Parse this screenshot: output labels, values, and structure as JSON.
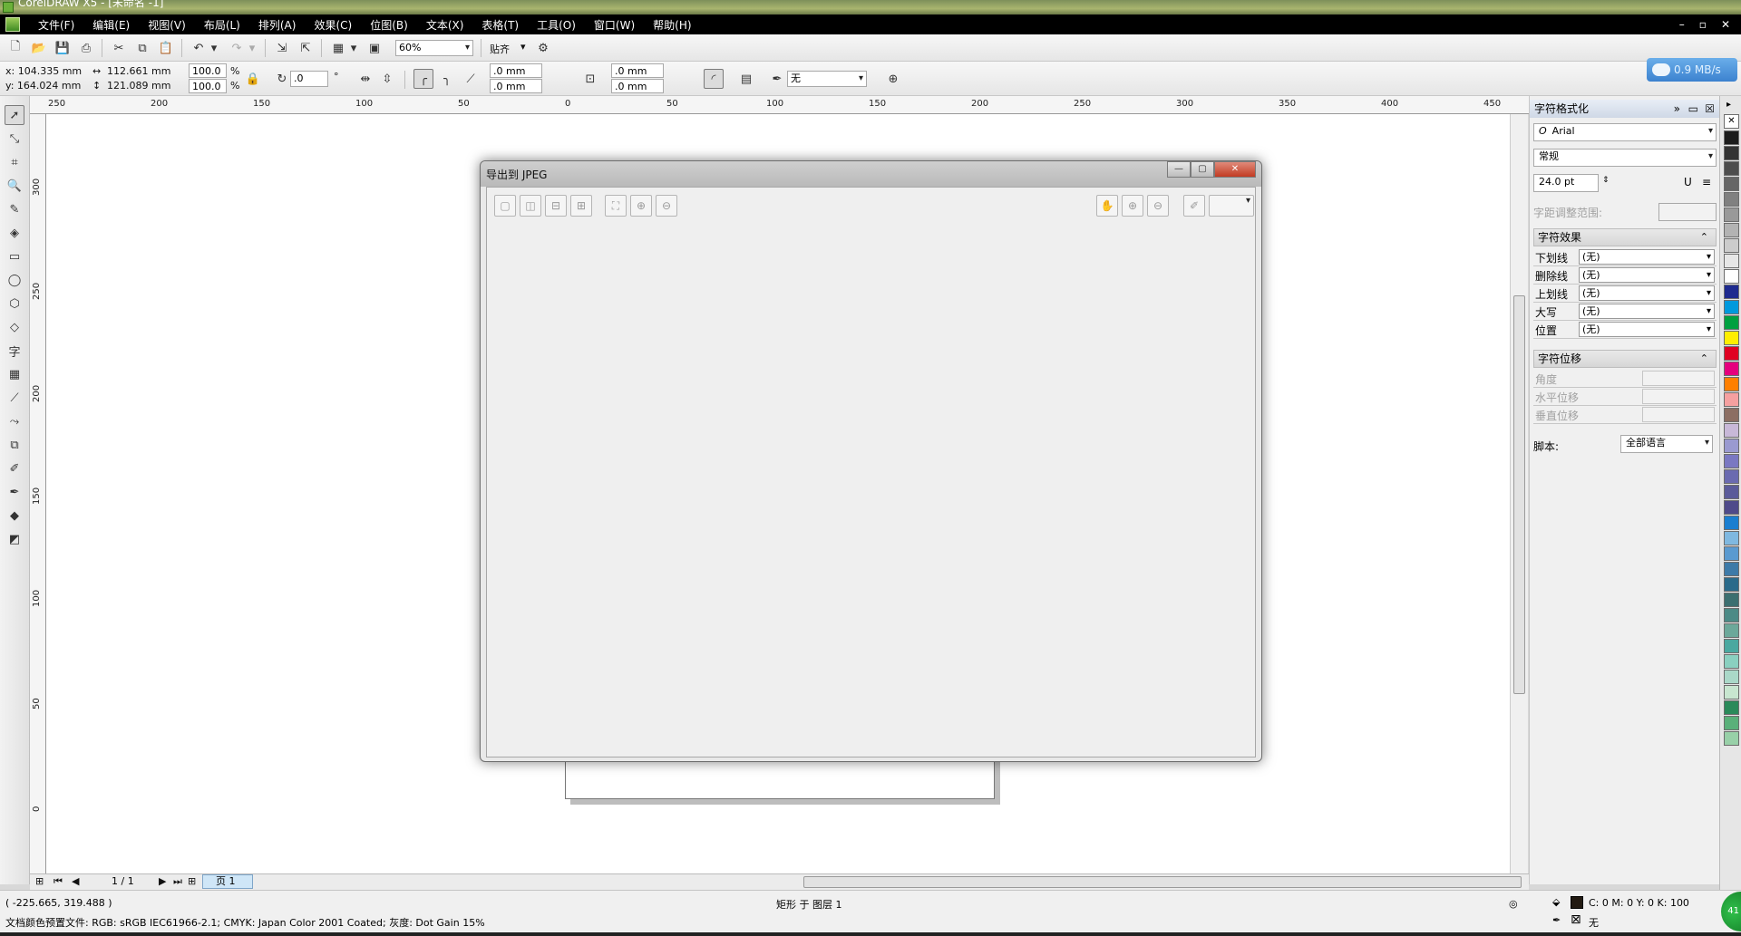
{
  "window": {
    "title": "CorelDRAW X5 - [未命名 -1]"
  },
  "menu": [
    "文件(F)",
    "编辑(E)",
    "视图(V)",
    "布局(L)",
    "排列(A)",
    "效果(C)",
    "位图(B)",
    "文本(X)",
    "表格(T)",
    "工具(O)",
    "窗口(W)",
    "帮助(H)"
  ],
  "toolbar": {
    "zoom": "60%",
    "snap": "贴齐"
  },
  "property_bar": {
    "x": "x: 104.335 mm",
    "y": "y: 164.024 mm",
    "width": "112.661 mm",
    "height": "121.089 mm",
    "scale_w": "100.0",
    "scale_h": "100.0",
    "pct1": "%",
    "pct2": "%",
    "rotation": ".0",
    "degree": "°",
    "corner1": ".0 mm",
    "corner2": ".0 mm",
    "corner3": ".0 mm",
    "corner4": ".0 mm",
    "outline": "无"
  },
  "speed": "0.9 MB/s",
  "ruler": {
    "h": [
      "250",
      "200",
      "150",
      "100",
      "50",
      "0",
      "50",
      "100",
      "150",
      "200",
      "250",
      "300",
      "350",
      "400",
      "450"
    ],
    "v": [
      "300",
      "250",
      "200",
      "150",
      "100",
      "50",
      "0"
    ]
  },
  "dialog": {
    "title": "导出到 JPEG"
  },
  "pagenav": {
    "counter": "1 / 1",
    "tab": "页 1"
  },
  "status": {
    "coords": "( -225.665, 319.488 )",
    "selection": "矩形 于 图层 1",
    "color_profile": "文档颜色预置文件: RGB: sRGB IEC61966-2.1; CMYK: Japan Color 2001 Coated; 灰度: Dot Gain 15%",
    "fill": "C: 0 M: 0 Y: 0 K: 100",
    "outline": "无"
  },
  "docker": {
    "title": "字符格式化",
    "font": "Arial",
    "style": "常规",
    "size": "24.0 pt",
    "kerning_label": "字距调整范围:",
    "effects_title": "字符效果",
    "effects": [
      {
        "label": "下划线",
        "value": "(无)"
      },
      {
        "label": "删除线",
        "value": "(无)"
      },
      {
        "label": "上划线",
        "value": "(无)"
      },
      {
        "label": "大写",
        "value": "(无)"
      },
      {
        "label": "位置",
        "value": "(无)"
      }
    ],
    "shift_title": "字符位移",
    "shift": [
      "角度",
      "水平位移",
      "垂直位移"
    ],
    "script_label": "脚本:",
    "script_value": "全部语言"
  },
  "palette": [
    "#1c1c1c",
    "#333333",
    "#4d4d4d",
    "#666666",
    "#808080",
    "#999999",
    "#b3b3b3",
    "#cccccc",
    "#e6e6e6",
    "#ffffff",
    "#1e2a8f",
    "#0099dd",
    "#00a040",
    "#ffee00",
    "#e00022",
    "#e5007e",
    "#ff7f00",
    "#f5a0a0",
    "#8c6e63",
    "#c8b8d8",
    "#9a9ad0",
    "#7a78c2",
    "#6a6ab0",
    "#5a5a9a",
    "#4f4a8a",
    "#1a7ed0",
    "#7fb8e0",
    "#5a9ad0",
    "#3d7aa8",
    "#2a6a8a",
    "#3c6f70",
    "#4c8a86",
    "#6ca89a",
    "#4aa8a0",
    "#8ad0c0",
    "#aad8c8",
    "#c8e6d0",
    "#2a8a5a",
    "#5ab07a",
    "#98d0a8"
  ]
}
